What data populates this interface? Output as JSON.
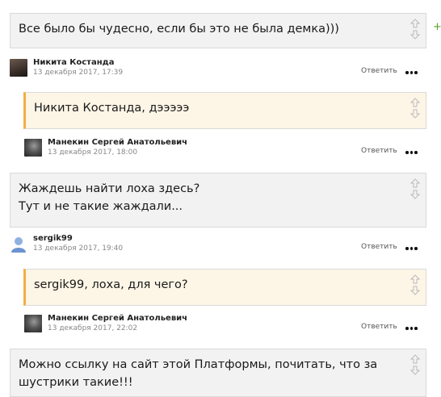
{
  "comments": [
    {
      "text": "Все было бы чудесно, если бы это не была демка)))"
    },
    {
      "author": "Никита Костанда",
      "date": "13 декабря 2017, 17:39",
      "reply": "Ответить"
    },
    {
      "text": "Никита Костанда, дэээээ"
    },
    {
      "author": "Манекин Сергей Анатольевич",
      "date": "13 декабря 2017, 18:00",
      "reply": "Ответить"
    },
    {
      "text_line1": "Жаждешь найти лоха здесь?",
      "text_line2": "Тут и не такие жаждали..."
    },
    {
      "author": "sergik99",
      "date": "13 декабря 2017, 19:40",
      "reply": "Ответить"
    },
    {
      "text": "sergik99, лоха, для чего?"
    },
    {
      "author": "Манекин Сергей Анатольевич",
      "date": "13 декабря 2017, 22:02",
      "reply": "Ответить"
    },
    {
      "text_line1": "Можно  ссылку на сайт этой Платформы, почитать, что за",
      "text_line2": "шустрики такие!!!"
    }
  ],
  "plus_symbol": "+",
  "icons": {
    "vote_up": "thumb-up-icon",
    "vote_down": "thumb-down-icon",
    "more": "more-dots-icon"
  },
  "colors": {
    "bubble_bg": "#f2f2f2",
    "reply_bg": "#fdf5e6",
    "reply_accent": "#f0b040",
    "plus": "#5aa02c"
  }
}
